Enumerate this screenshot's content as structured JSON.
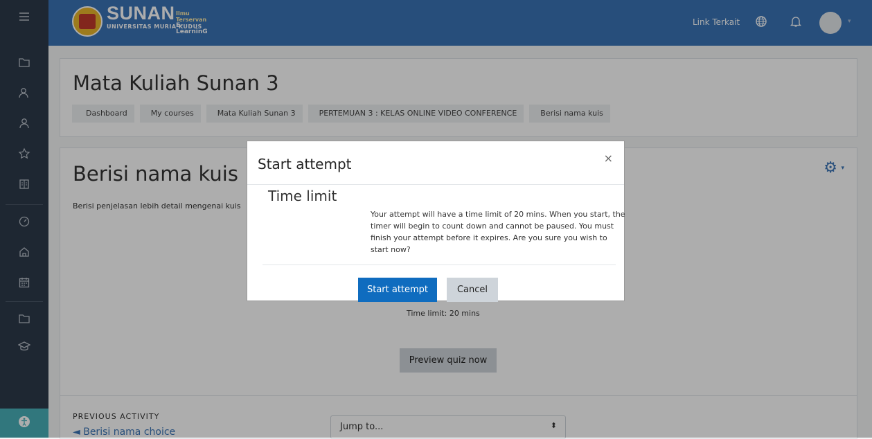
{
  "header": {
    "brand_name": "SUNAN",
    "brand_tag": "Ilmu Terservan",
    "brand_sub": "E-LearninG",
    "brand_university": "UNIVERSITAS MURIA KUDUS",
    "link_label": "Link Terkait",
    "icons": [
      "language-icon",
      "bell-icon",
      "user-avatar"
    ]
  },
  "sidebar": {
    "items": [
      "folder-icon",
      "users-icon",
      "user-check-icon",
      "star-icon",
      "book-icon",
      "dashboard-icon",
      "home-icon",
      "calendar-icon",
      "folder-icon",
      "graduation-cap-icon",
      "accessibility-icon"
    ]
  },
  "course": {
    "title": "Mata Kuliah Sunan 3",
    "breadcrumb": [
      "Dashboard",
      "My courses",
      "Mata Kuliah Sunan 3",
      "PERTEMUAN 3 : KELAS ONLINE VIDEO CONFERENCE",
      "Berisi nama kuis"
    ]
  },
  "quiz": {
    "title": "Berisi nama kuis",
    "description": "Berisi penjelasan lebih detail mengenai kuis",
    "time_limit_text": "Time limit: 20 mins",
    "preview_label": "Preview quiz now",
    "previous_activity_label": "PREVIOUS ACTIVITY",
    "previous_activity_link": "◄ Berisi nama choice",
    "jump_label": "Jump to..."
  },
  "modal": {
    "title": "Start attempt",
    "close_label": "×",
    "heading": "Time limit",
    "body": "Your attempt will have a time limit of 20 mins. When you start, the timer will begin to count down and cannot be paused. You must finish your attempt before it expires. Are you sure you wish to start now?",
    "start_label": "Start attempt",
    "cancel_label": "Cancel"
  },
  "colors": {
    "header_bg": "#3a74b6",
    "sidebar_bg": "#2d3a4a",
    "primary": "#0f6cbf",
    "accessibility": "#49b0b8"
  }
}
